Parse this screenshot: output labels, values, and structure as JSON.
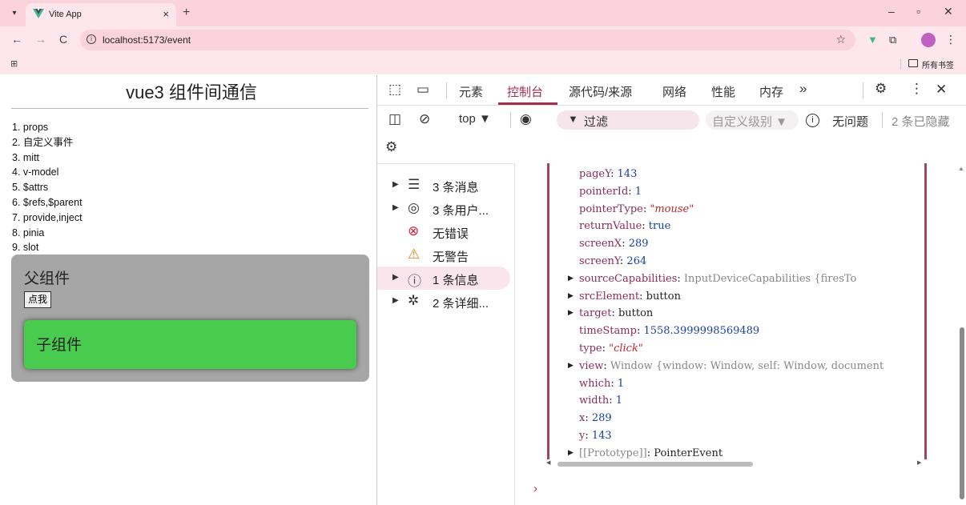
{
  "browser": {
    "tab_title": "Vite App",
    "tab_close": "×",
    "new_tab": "+",
    "url": "localhost:5173/event",
    "bookmarks_folder": "所有书签",
    "window_controls": {
      "minimize": "–",
      "maximize": "▫",
      "close": "✕"
    },
    "nav": {
      "back": "←",
      "forward": "→",
      "reload": "C"
    }
  },
  "page": {
    "title": "vue3 组件间通信",
    "menu": [
      "1. props",
      "2. 自定义事件",
      "3. mitt",
      "4. v-model",
      "5. $attrs",
      "6. $refs,$parent",
      "7. provide,inject",
      "8. pinia",
      "9. slot"
    ],
    "parent": {
      "title": "父组件",
      "button_label": "点我",
      "bg_color": "#a6a6a6"
    },
    "child": {
      "title": "子组件",
      "bg_color": "#48cb4f"
    }
  },
  "devtools": {
    "tabs": [
      "元素",
      "控制台",
      "源代码/来源",
      "网络",
      "性能",
      "内存"
    ],
    "active_tab": "控制台",
    "more_tabs": "»",
    "context": "top ▼",
    "filter_placeholder": "过滤",
    "level_select": "自定义级别 ▼",
    "issues": "无问题",
    "hidden": "2 条已隐藏",
    "accent_color": "#a03050",
    "sidebar": [
      {
        "label": "3 条消息",
        "icon": "list-icon",
        "expandable": true
      },
      {
        "label": "3 条用户...",
        "icon": "user-icon",
        "expandable": true
      },
      {
        "label": "无错误",
        "icon": "error-icon",
        "expandable": false
      },
      {
        "label": "无警告",
        "icon": "warning-icon",
        "expandable": false
      },
      {
        "label": "1 条信息",
        "icon": "info-icon",
        "expandable": true,
        "selected": true
      },
      {
        "label": "2 条详细...",
        "icon": "bug-icon",
        "expandable": true
      }
    ],
    "console_props": [
      {
        "key": "pageY",
        "value": "143",
        "type": "number",
        "expandable": false
      },
      {
        "key": "pointerId",
        "value": "1",
        "type": "number",
        "expandable": false
      },
      {
        "key": "pointerType",
        "value": "\"mouse\"",
        "type": "string",
        "expandable": false
      },
      {
        "key": "returnValue",
        "value": "true",
        "type": "number",
        "expandable": false
      },
      {
        "key": "screenX",
        "value": "289",
        "type": "number",
        "expandable": false
      },
      {
        "key": "screenY",
        "value": "264",
        "type": "number",
        "expandable": false
      },
      {
        "key": "sourceCapabilities",
        "value": "InputDeviceCapabilities  {firesTo",
        "type": "grey",
        "expandable": true
      },
      {
        "key": "srcElement",
        "value": "button",
        "type": "object",
        "expandable": true
      },
      {
        "key": "target",
        "value": "button",
        "type": "object",
        "expandable": true
      },
      {
        "key": "timeStamp",
        "value": "1558.3999998569489",
        "type": "number",
        "expandable": false
      },
      {
        "key": "type",
        "value": "\"click\"",
        "type": "string",
        "expandable": false
      },
      {
        "key": "view",
        "value": "Window  {window: Window, self: Window, document",
        "type": "grey",
        "expandable": true
      },
      {
        "key": "which",
        "value": "1",
        "type": "number",
        "expandable": false
      },
      {
        "key": "width",
        "value": "1",
        "type": "number",
        "expandable": false
      },
      {
        "key": "x",
        "value": "289",
        "type": "number",
        "expandable": false
      },
      {
        "key": "y",
        "value": "143",
        "type": "number",
        "expandable": false
      },
      {
        "key": "[[Prototype]]",
        "value": "PointerEvent",
        "type": "object",
        "expandable": true
      }
    ],
    "prompt": "›"
  }
}
